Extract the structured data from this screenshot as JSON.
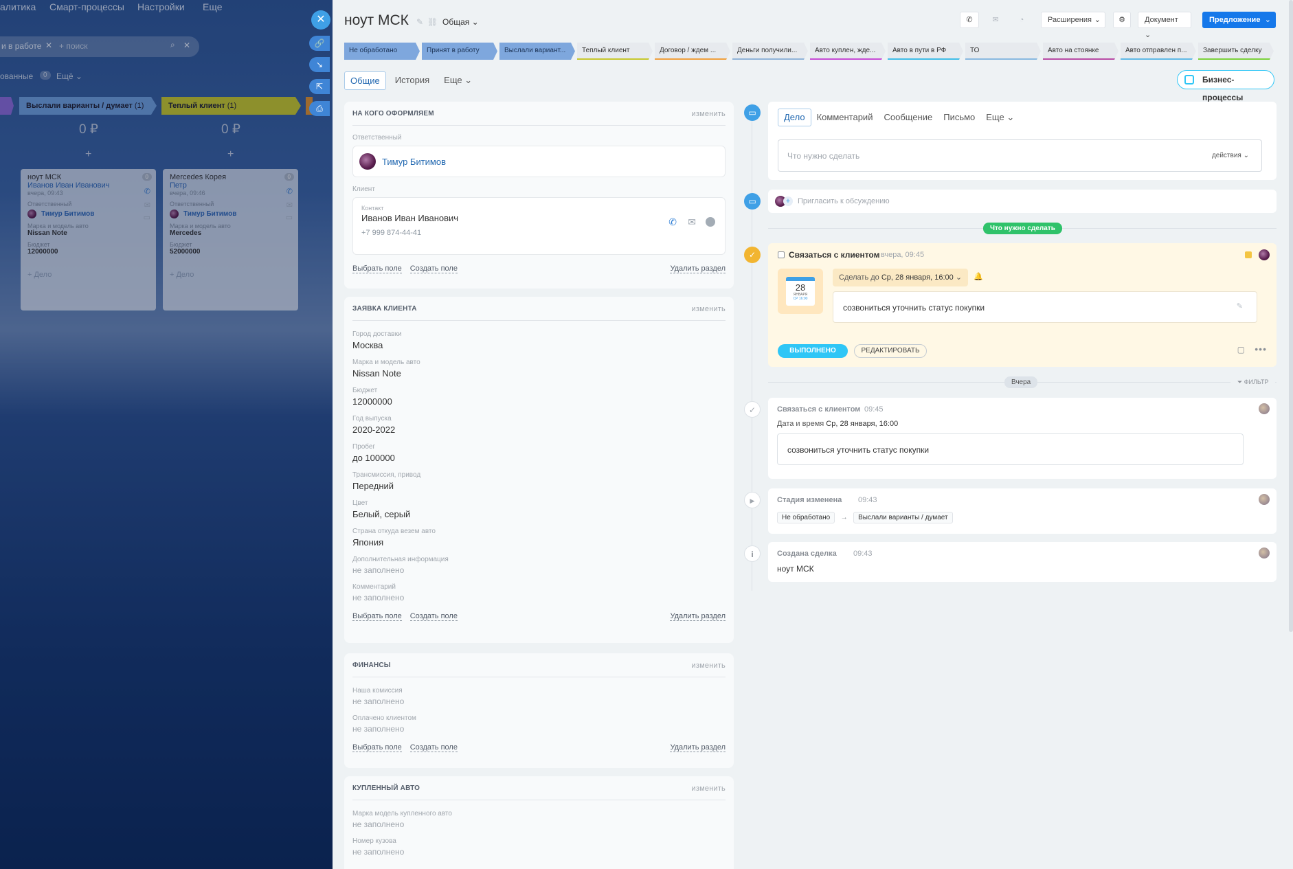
{
  "background": {
    "topbar": [
      "алитика",
      "Смарт-процессы",
      "Настройки",
      "Еще"
    ],
    "filter_tag": "и в работе",
    "search_placeholder": "+ поиск",
    "row2_label": "ованные",
    "row2_count": "0",
    "row2_more": "Ещё",
    "columns": [
      {
        "title": "Выслали варианты / думает",
        "count": "(1)",
        "color": "#5b92d8",
        "sum": "0 ₽",
        "card": {
          "title": "ноут МСК",
          "contact": "Иванов Иван Иванович",
          "date": "вчера, 09:43",
          "resp_label": "Ответственный",
          "resp": "Тимур Битимов",
          "car_label": "Марка и модель авто",
          "car": "Nissan Note",
          "budget_label": "Бюджет",
          "budget": "12000000",
          "add": "+ Дело",
          "badge": "0"
        }
      },
      {
        "title": "Теплый клиент",
        "count": "(1)",
        "color": "#c7c72b",
        "sum": "0 ₽",
        "card": {
          "title": "Mercedes Корея",
          "contact": "Петр",
          "date": "вчера, 09:46",
          "resp_label": "Ответственный",
          "resp": "Тимур Битимов",
          "car_label": "Марка и модель авто",
          "car": "Mercedes",
          "budget_label": "Бюджет",
          "budget": "52000000",
          "add": "+ Дело",
          "badge": "0"
        }
      }
    ]
  },
  "header": {
    "title": "ноут МСК",
    "category": "Общая",
    "extensions": "Расширения",
    "document": "Документ",
    "offer": "Предложение"
  },
  "stages": [
    {
      "label": "Не обработано",
      "done": true,
      "color": "#7ea7dd"
    },
    {
      "label": "Принят в работу",
      "done": true,
      "color": "#7ea7dd"
    },
    {
      "label": "Выслали вариант...",
      "done": true,
      "color": "#7ea7dd"
    },
    {
      "label": "Теплый клиент",
      "done": false,
      "color": "#c7c72b"
    },
    {
      "label": "Договор / ждем ...",
      "done": false,
      "color": "#f0a03c"
    },
    {
      "label": "Деньги получили...",
      "done": false,
      "color": "#8fb3d9"
    },
    {
      "label": "Авто куплен, жде...",
      "done": false,
      "color": "#c64ad6"
    },
    {
      "label": "Авто в пути в РФ",
      "done": false,
      "color": "#3fbde8"
    },
    {
      "label": "ТО",
      "done": false,
      "color": "#88b8e0"
    },
    {
      "label": "Авто на стоянке",
      "done": false,
      "color": "#b84aa5"
    },
    {
      "label": "Авто отправлен п...",
      "done": false,
      "color": "#5fb9e6"
    },
    {
      "label": "Завершить сделку",
      "done": false,
      "color": "#7bd13a"
    }
  ],
  "tabs": [
    "Общие",
    "История",
    "Еще"
  ],
  "business_processes": "Бизнес-процессы",
  "sections": {
    "who": {
      "title": "НА КОГО ОФОРМЛЯЕМ",
      "change": "изменить",
      "resp_label": "Ответственный",
      "resp_name": "Тимур Битимов",
      "client_label": "Клиент",
      "contact_label": "Контакт",
      "contact_name": "Иванов Иван Иванович",
      "contact_phone": "+7 999 874-44-41",
      "choose": "Выбрать поле",
      "create": "Создать поле",
      "delete": "Удалить раздел"
    },
    "request": {
      "title": "ЗАЯВКА КЛИЕНТА",
      "change": "изменить",
      "fields": [
        {
          "label": "Город доставки",
          "value": "Москва"
        },
        {
          "label": "Марка и модель авто",
          "value": "Nissan Note"
        },
        {
          "label": "Бюджет",
          "value": "12000000"
        },
        {
          "label": "Год выпуска",
          "value": "2020-2022"
        },
        {
          "label": "Пробег",
          "value": "до 100000"
        },
        {
          "label": "Трансмиссия, привод",
          "value": "Передний"
        },
        {
          "label": "Цвет",
          "value": "Белый, серый"
        },
        {
          "label": "Страна откуда везем авто",
          "value": "Япония"
        },
        {
          "label": "Дополнительная информация",
          "value": "не заполнено"
        },
        {
          "label": "Комментарий",
          "value": "не заполнено"
        }
      ],
      "choose": "Выбрать поле",
      "create": "Создать поле",
      "delete": "Удалить раздел"
    },
    "finance": {
      "title": "ФИНАНСЫ",
      "change": "изменить",
      "fields": [
        {
          "label": "Наша комиссия",
          "value": "не заполнено"
        },
        {
          "label": "Оплачено клиентом",
          "value": "не заполнено"
        }
      ],
      "choose": "Выбрать поле",
      "create": "Создать поле",
      "delete": "Удалить раздел"
    },
    "bought": {
      "title": "КУПЛЕННЫЙ АВТО",
      "change": "изменить",
      "fields": [
        {
          "label": "Марка модель купленного авто",
          "value": "не заполнено"
        },
        {
          "label": "Номер кузова",
          "value": "не заполнено"
        }
      ]
    }
  },
  "timeline": {
    "editor_tabs": [
      "Дело",
      "Комментарий",
      "Сообщение",
      "Письмо",
      "Еще"
    ],
    "todo_placeholder": "Что нужно сделать",
    "actions": "действия",
    "invite": "Пригласить к обсуждению",
    "todo_pill": "Что нужно сделать",
    "task": {
      "title": "Связаться с клиентом",
      "time": "вчера, 09:45",
      "cal_day": "28",
      "cal_month": "ЯНВАРЯ",
      "cal_weekday": "СР 16:00",
      "deadline_prefix": "Сделать до",
      "deadline": "Ср, 28 января, 16:00",
      "text": "созвониться уточнить статус покупки",
      "done_btn": "ВЫПОЛНЕНО",
      "edit_btn": "РЕДАКТИРОВАТЬ"
    },
    "yesterday": "Вчера",
    "filter": "ФИЛЬТР",
    "history": [
      {
        "kind": "task",
        "title": "Связаться с клиентом",
        "time": "09:45",
        "date_label": "Дата и время",
        "date": "Ср, 28 января, 16:00",
        "text": "созвониться уточнить статус покупки"
      },
      {
        "kind": "stage",
        "title": "Стадия изменена",
        "time": "09:43",
        "from": "Не обработано",
        "to": "Выслали варианты / думает"
      },
      {
        "kind": "created",
        "title": "Создана сделка",
        "time": "09:43",
        "text": "ноут МСК"
      }
    ]
  }
}
